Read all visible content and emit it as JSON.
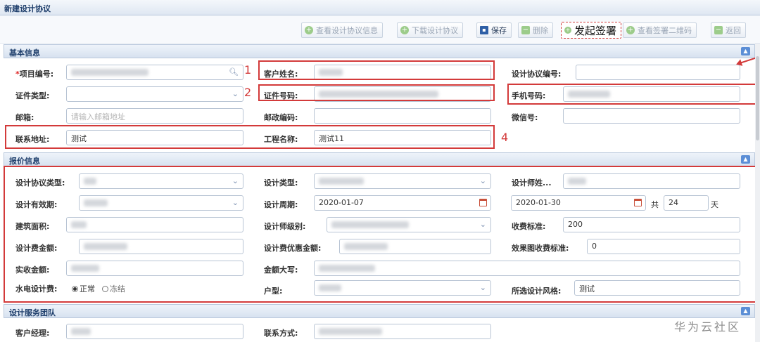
{
  "window": {
    "title": "新建设计协议"
  },
  "toolbar": {
    "view_info": "查看设计协议信息",
    "download": "下载设计协议",
    "save": "保存",
    "delete": "删除",
    "sign": "发起签署",
    "view_qr": "查看签署二维码",
    "back": "返回"
  },
  "sections": {
    "basic": "基本信息",
    "quote": "报价信息",
    "team": "设计服务团队"
  },
  "basic": {
    "project_no_label": "项目编号:",
    "customer_name_label": "客户姓名:",
    "agreement_no_label": "设计协议编号:",
    "id_type_label": "证件类型:",
    "id_no_label": "证件号码:",
    "mobile_label": "手机号码:",
    "email_label": "邮箱:",
    "email_placeholder": "请输入邮箱地址",
    "postcode_label": "邮政编码:",
    "wechat_label": "微信号:",
    "address_label": "联系地址:",
    "address_value": "测试",
    "project_name_label": "工程名称:",
    "project_name_value": "测试11"
  },
  "quote": {
    "agreement_type_label": "设计协议类型:",
    "design_type_label": "设计类型:",
    "designer_name_label": "设计师姓...",
    "validity_label": "设计有效期:",
    "period_label": "设计周期:",
    "period_start": "2020-01-07",
    "period_end": "2020-01-30",
    "total_prefix": "共",
    "total_days": "24",
    "days_unit": "天",
    "area_label": "建筑面积:",
    "designer_level_label": "设计师级别:",
    "fee_standard_label": "收费标准:",
    "fee_standard_value": "200",
    "design_fee_label": "设计费金额:",
    "discount_label": "设计费优惠金额:",
    "render_fee_label": "效果图收费标准:",
    "render_fee_value": "0",
    "actual_label": "实收金额:",
    "amount_words_label": "金额大写:",
    "mep_label": "水电设计费:",
    "mep_normal": "正常",
    "mep_frozen": "冻结",
    "house_type_label": "户型:",
    "style_label": "所选设计风格:",
    "style_value": "测试"
  },
  "team": {
    "manager_label": "客户经理:",
    "contact_label": "联系方式:"
  },
  "annotations": {
    "n1": "1",
    "n2": "2",
    "n4": "4"
  },
  "watermark": "华为云社区"
}
